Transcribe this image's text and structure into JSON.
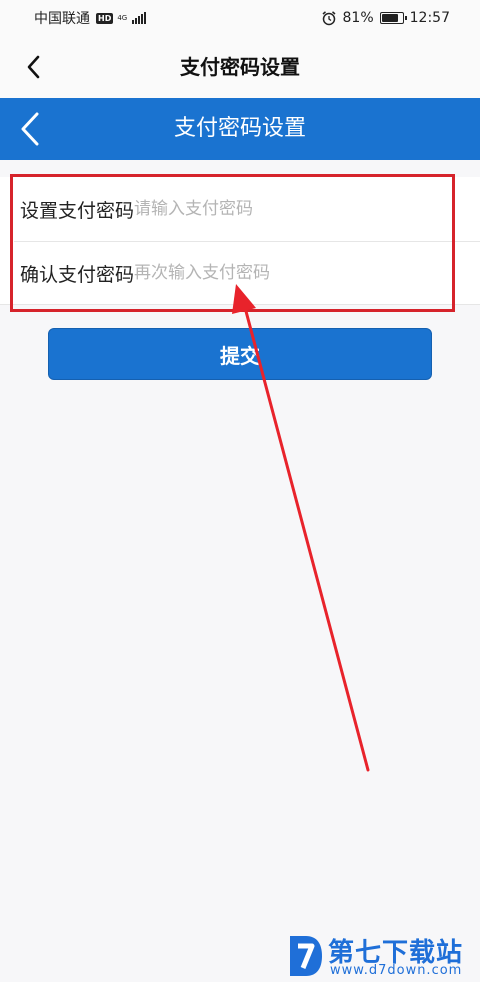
{
  "status_bar": {
    "carrier": "中国联通",
    "hd_badge": "HD",
    "network_type": "4G",
    "battery_percent": "81%",
    "battery_level": 0.81,
    "time": "12:57"
  },
  "native_bar": {
    "title": "支付密码设置",
    "back_icon": "chevron-left-icon"
  },
  "app_header": {
    "title": "支付密码设置",
    "back_icon": "chevron-left-icon",
    "color": "#1a73d0"
  },
  "form": {
    "set_password_label": "设置支付密码",
    "set_password_placeholder": "请输入支付密码",
    "set_password_value": "",
    "confirm_password_label": "确认支付密码",
    "confirm_password_placeholder": "再次输入支付密码",
    "confirm_password_value": ""
  },
  "submit": {
    "label": "提交"
  },
  "annotation": {
    "highlight_color": "#d6232b"
  },
  "watermark": {
    "name": "第七下载站",
    "url": "www.d7down.com",
    "color": "#1f6fd8"
  }
}
